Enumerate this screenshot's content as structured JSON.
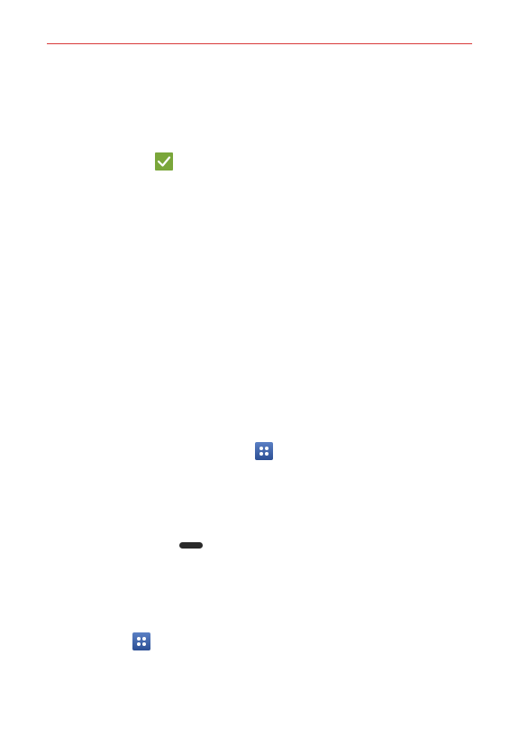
{
  "colors": {
    "header_rule": "#d83a3a",
    "check_icon": "#7aa63a",
    "apps_icon": "#3a5ea8",
    "menu_key": "#2a2a2a"
  },
  "icons": [
    "checkmark-icon",
    "apps-icon",
    "menu-key-icon",
    "apps-icon"
  ]
}
